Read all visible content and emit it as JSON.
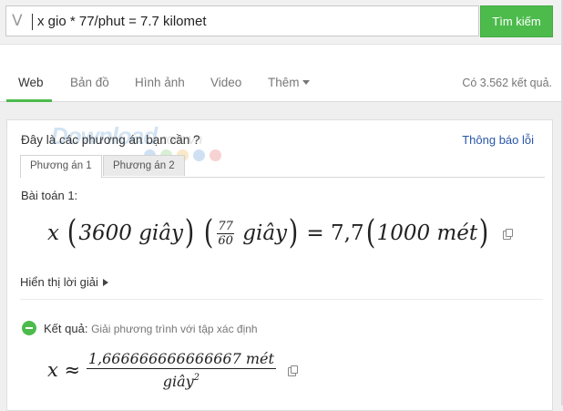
{
  "search": {
    "logo_letter": "V",
    "query": "x gio * 77/phut = 7.7 kilomet",
    "button_label": "Tìm kiếm"
  },
  "nav": {
    "tabs": [
      {
        "label": "Web",
        "active": true
      },
      {
        "label": "Bản đồ",
        "active": false
      },
      {
        "label": "Hình ảnh",
        "active": false
      },
      {
        "label": "Video",
        "active": false
      },
      {
        "label": "Thêm",
        "active": false
      }
    ],
    "result_count": "Có 3.562 kết quả."
  },
  "card": {
    "watermark": "Download",
    "watermark_domain": ".com.vn",
    "question": "Đây là các phương án bạn cần ?",
    "report_link": "Thông báo lỗi",
    "option_tabs": [
      {
        "label": "Phương án 1",
        "active": true
      },
      {
        "label": "Phương án 2",
        "active": false
      }
    ],
    "problem_title": "Bài toán 1:",
    "equation": {
      "var": "x",
      "term1": "3600 giây",
      "frac_num": "77",
      "frac_den": "60",
      "term2": "giây",
      "equals": "=",
      "rhs_coef": "7,7",
      "rhs_term": "1000 mét"
    },
    "show_solution": "Hiển thị lời giải",
    "result_label": "Kết quả:",
    "result_subtitle": "Giải phương trình với tập xác định",
    "result": {
      "var": "x",
      "approx": "≈",
      "numerator": "1,666666666666667 mét",
      "denominator": "giây",
      "exponent": "2"
    }
  },
  "colors": {
    "accent": "#4cbb4c",
    "link": "#2a56a8"
  },
  "icons": [
    "copy-icon",
    "play-triangle-icon",
    "result-icon",
    "dropdown-triangle-icon"
  ]
}
